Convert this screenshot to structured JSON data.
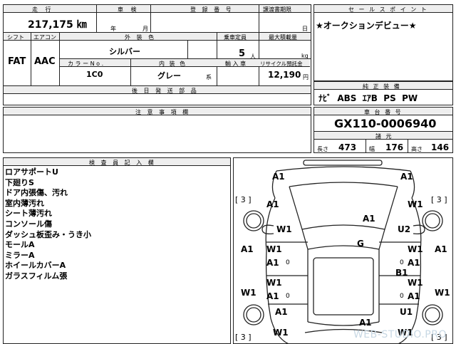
{
  "sheet": {
    "left_top": {
      "mileage_label": "走 行",
      "mileage_value": "217,175 ㎞",
      "inspection_label": "車 検",
      "inspection_year": "年",
      "inspection_month": "月",
      "registration_label": "登 録 番 号",
      "transfer_deadline_label": "譲渡書期限",
      "transfer_day": "日"
    },
    "row2": {
      "shift_label": "シフト",
      "shift_value": "FAT",
      "ac_label": "エアコン",
      "ac_value": "AAC",
      "exterior_color_label": "外 装 色",
      "exterior_color_value": "シルバー",
      "capacity_label": "乗車定員",
      "capacity_value": "5",
      "capacity_unit": "人",
      "max_load_label": "最大積載量",
      "max_load_unit": "kg",
      "color_no_label": "カ ラ ー N o .",
      "color_no_value": "1C0",
      "interior_color_label": "内 装 色",
      "interior_color_value": "グレー",
      "interior_color_suffix": "系",
      "import_label": "輸 入 車",
      "recycle_label": "リサイクル預託金",
      "recycle_value": "12,190",
      "recycle_unit": "円"
    },
    "later_docs_label": "後 日 発 送 部 品",
    "caution_label": "注 意 事 項 欄",
    "sales_point_label": "セ ー ル ス ポ イ ン ト",
    "sales_point_value": "★オークションデビュー★",
    "equipment_label": "純 正 装 備",
    "equipment_value": "ﾅﾋﾞ  ABS  ｴｱB  PS  PW",
    "chassis_label": "車 台 番 号",
    "chassis_value": "GX110-0006940",
    "dims_label": "諸 元",
    "length_label": "長さ",
    "length_value": "473",
    "width_label": "幅",
    "width_value": "176",
    "height_label": "高さ",
    "height_value": "146",
    "inspector_label": "検 査 員 記 入 欄",
    "inspector_notes": [
      "ロアサポートU",
      "下廻りS",
      "ドア内張傷、汚れ",
      "室内薄汚れ",
      "シート薄汚れ",
      "コンソール傷",
      "ダッシュ板歪み・うき小",
      "モールA",
      "ミラーA",
      "ホイールカバーA",
      "ガラスフィルム張"
    ],
    "watermark": "WEB-STUDIO.PRO"
  },
  "diagram_marks": {
    "front_left_bumper": "A1",
    "front_right_bumper": "A1",
    "left_front_tire": "[ 3 ]",
    "right_front_tire": "[ 3 ]",
    "left_fender_top": "A1",
    "right_fender_top": "W1",
    "left_fender_low": "W1",
    "right_fender_low": "U2",
    "hood": "A1",
    "roof": "G",
    "left_pillar": "A1",
    "right_pillar": "A1",
    "left_front_door_w": "W1",
    "left_front_door_a": "A1",
    "left_front_door_n": "0",
    "right_front_door_w": "W1",
    "right_front_door_a": "A1",
    "right_front_door_n": "0",
    "right_center": "B1",
    "left_rear_door_w": "W1",
    "left_rear_door_a": "A1",
    "left_rear_door_n": "0",
    "right_rear_door_w": "W1",
    "right_rear_door_a": "A1",
    "right_rear_door_n": "0",
    "left_sill": "W1",
    "right_sill": "W1",
    "left_rear_fender": "A1",
    "right_rear_fender": "U1",
    "left_rear_tire": "[ 3 ]",
    "right_rear_tire": "[ 3 ]",
    "left_rear_low": "W1",
    "trunk": "A1",
    "rear_right": "W1"
  }
}
